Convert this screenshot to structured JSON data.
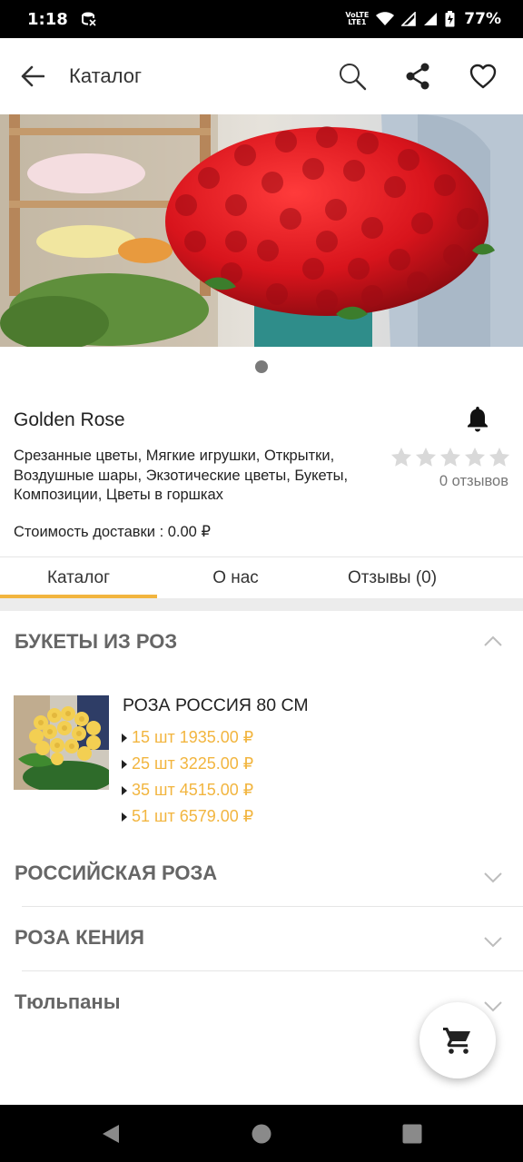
{
  "status_bar": {
    "time": "1:18",
    "volte_line1": "VoLTE",
    "volte_line2": "LTE1",
    "battery": "77%"
  },
  "app_bar": {
    "title": "Каталог",
    "icons": [
      "back-arrow-icon",
      "search-icon",
      "share-icon",
      "heart-icon"
    ]
  },
  "shop": {
    "name": "Golden Rose",
    "description": "Срезанные цветы, Мягкие игрушки, Открытки, Воздушные шары, Экзотические цветы, Букеты, Композиции, Цветы в горшках",
    "delivery": "Стоимость доставки : 0.00 ₽",
    "rating_stars": 0,
    "rating_max": 5,
    "reviews": "0 отзывов"
  },
  "tabs": [
    {
      "label": "Каталог",
      "active": true
    },
    {
      "label": "О нас",
      "active": false
    },
    {
      "label": "Отзывы (0)",
      "active": false
    }
  ],
  "sections": [
    {
      "title": "БУКЕТЫ ИЗ РОЗ",
      "expanded": true
    },
    {
      "title": "РОССИЙСКАЯ РОЗА",
      "expanded": false
    },
    {
      "title": "РОЗА КЕНИЯ",
      "expanded": false
    },
    {
      "title": "Тюльпаны",
      "expanded": false
    }
  ],
  "product": {
    "name": "РОЗА РОССИЯ 80 СМ",
    "prices": [
      "15 шт 1935.00 ₽",
      "25 шт 3225.00 ₽",
      "35 шт 4515.00 ₽",
      "51 шт 6579.00 ₽"
    ]
  },
  "colors": {
    "accent": "#f2b53f",
    "rose_red": "#c8141c",
    "section_title": "#666666"
  }
}
